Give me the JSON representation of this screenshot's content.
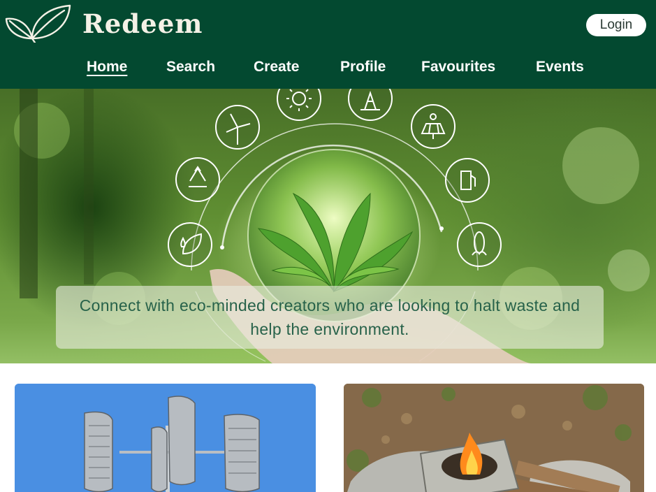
{
  "header": {
    "brand_name": "Redeem",
    "login_label": "Login",
    "logo_icon": "leaves-icon"
  },
  "nav": {
    "items": [
      {
        "label": "Home",
        "active": true
      },
      {
        "label": "Search",
        "active": false
      },
      {
        "label": "Create",
        "active": false
      },
      {
        "label": "Profile",
        "active": false
      },
      {
        "label": "Favourites",
        "active": false
      },
      {
        "label": "Events",
        "active": false
      }
    ]
  },
  "hero": {
    "caption": "Connect with eco-minded creators who are looking to halt waste and help the environment.",
    "icons": [
      "leaf-water-icon",
      "recycle-icon",
      "wind-turbine-icon",
      "sun-icon",
      "oil-pump-icon",
      "solar-panel-icon",
      "fuel-pump-icon",
      "corn-icon"
    ]
  },
  "cards": [
    {
      "image": "wind-turbine-photo"
    },
    {
      "image": "campfire-stove-photo"
    }
  ],
  "colors": {
    "header_bg": "#034930",
    "nav_text": "#ffffff",
    "caption_text": "#27624a"
  }
}
